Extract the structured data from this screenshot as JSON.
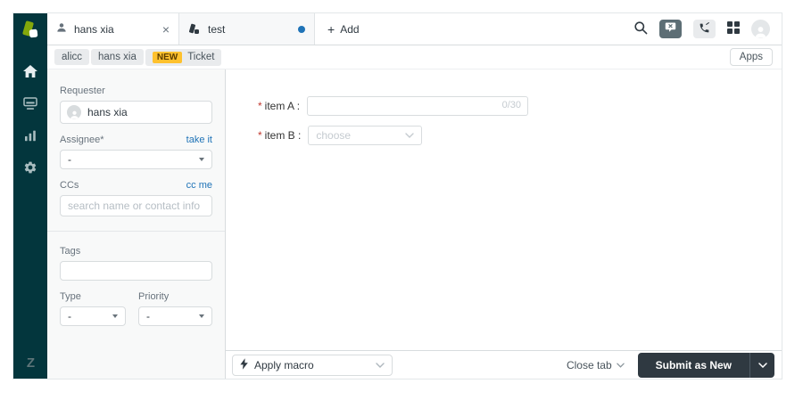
{
  "sidebar": {
    "items": [
      {
        "name": "home"
      },
      {
        "name": "views"
      },
      {
        "name": "reports"
      },
      {
        "name": "admin"
      }
    ]
  },
  "tabbar": {
    "tabs": [
      {
        "label": "hans xia",
        "close": "×"
      },
      {
        "label": "test"
      }
    ],
    "add_plus": "+",
    "add_label": "Add"
  },
  "breadcrumb": {
    "items": [
      "alicc",
      "hans xia"
    ],
    "status_badge": "NEW",
    "last": "Ticket"
  },
  "apps_button_label": "Apps",
  "ticket_panel": {
    "requester_label": "Requester",
    "requester_value": "hans xia",
    "assignee_label": "Assignee*",
    "take_it_link": "take it",
    "assignee_value": "-",
    "ccs_label": "CCs",
    "cc_me_link": "cc me",
    "ccs_placeholder": "search name or contact info",
    "tags_label": "Tags",
    "type_label": "Type",
    "type_value": "-",
    "priority_label": "Priority",
    "priority_value": "-"
  },
  "form": {
    "required_marker": "*",
    "item_a_label": "item A :",
    "item_a_counter": "0/30",
    "item_b_label": "item B :",
    "item_b_placeholder": "choose"
  },
  "footer": {
    "apply_macro_label": "Apply macro",
    "close_tab_label": "Close tab",
    "submit_label": "Submit as New"
  },
  "colors": {
    "sidebar_bg": "#03363d",
    "link_blue": "#1f73b7",
    "badge_new_bg": "#fec12e",
    "badge_new_text": "#5a3c00",
    "submit_bg": "#2f3941",
    "border": "#d8dcde",
    "panel_bg": "#f8f9f9",
    "placeholder_gray": "#b6bec4",
    "unsaved_dot": "#1f73b7",
    "logo_green": "#84a80b"
  }
}
